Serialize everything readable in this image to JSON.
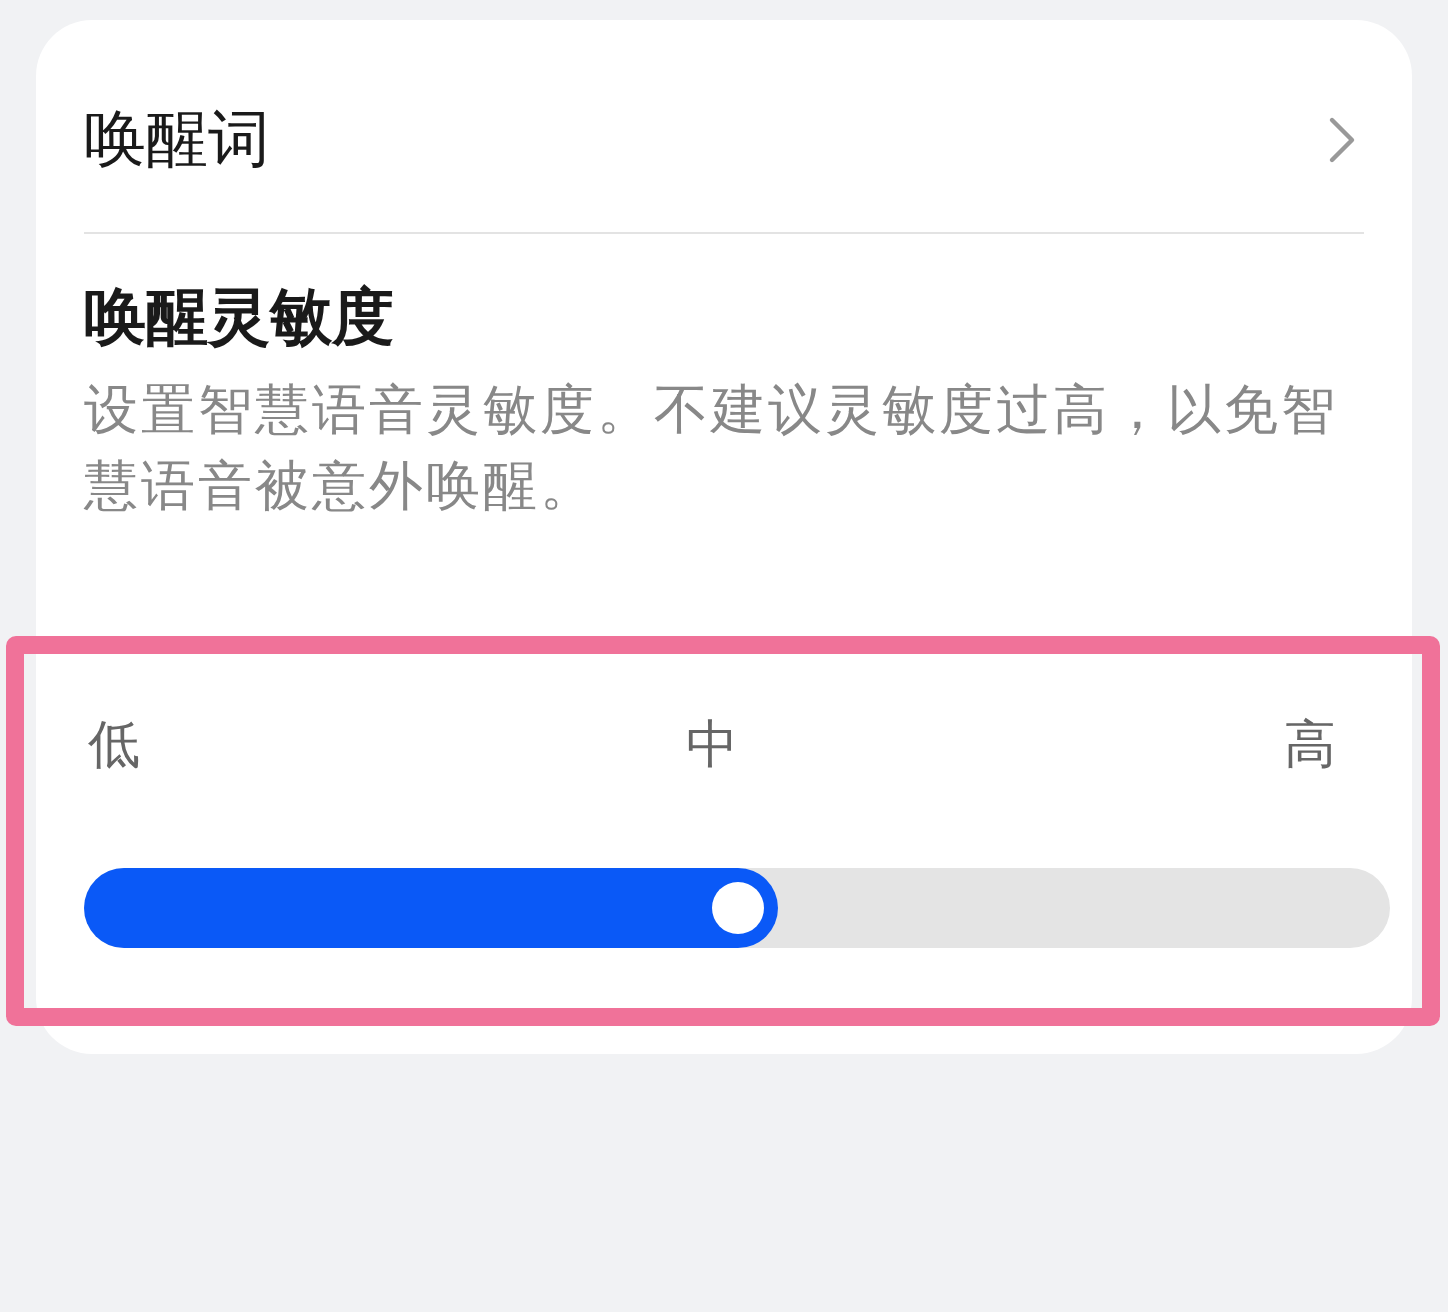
{
  "wake_word_row": {
    "label": "唤醒词"
  },
  "sensitivity": {
    "title": "唤醒灵敏度",
    "description": "设置智慧语音灵敏度。不建议灵敏度过高，以免智慧语音被意外唤醒。",
    "scale_labels": [
      "低",
      "中",
      "高"
    ],
    "slider": {
      "level": 0.5
    }
  }
}
